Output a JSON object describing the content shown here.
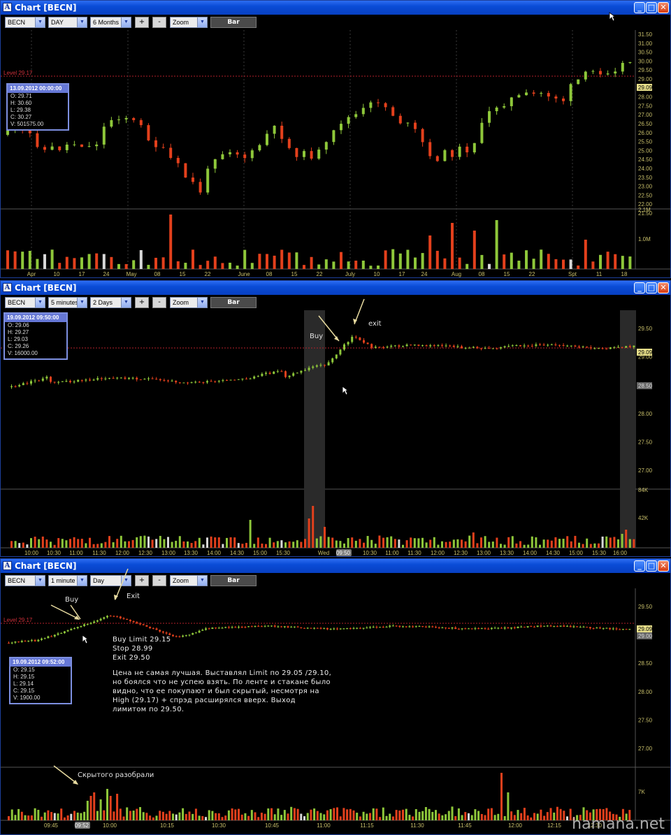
{
  "colors": {
    "up": "#8ec73a",
    "down": "#e3401c",
    "level": "#b3202a",
    "grid": "#3a3a3a",
    "axis": "#c8bf6a",
    "neutral": "#d8d8d8"
  },
  "windows": [
    {
      "title": "Chart [BECN]",
      "symbol": "BECN",
      "interval": "DAY",
      "range": "6 Months",
      "zoom_label": "Zoom",
      "plus_label": "+",
      "minus_label": "-",
      "bar_label": "Bar",
      "level_label": "Level 29.17",
      "info": {
        "date": "13.09.2012 00:00:00",
        "o": "O: 29.71",
        "h": "H: 30.60",
        "l": "L: 29.38",
        "c": "C: 30.27",
        "v": "V: 501575.00"
      },
      "price_ticks": [
        "31.50",
        "31.00",
        "30.50",
        "30.00",
        "29.50",
        "29.00",
        "28.50",
        "28.00",
        "27.50",
        "27.00",
        "26.50",
        "26.00",
        "25.50",
        "25.00",
        "24.50",
        "24.00",
        "23.50",
        "23.00",
        "22.50",
        "22.00",
        "21.50"
      ],
      "vol_ticks": [
        "2.1M",
        "1.0M"
      ],
      "time_ticks": [
        "Apr",
        "10",
        "17",
        "24",
        "May",
        "08",
        "15",
        "22",
        "June",
        "08",
        "15",
        "22",
        "July",
        "10",
        "17",
        "24",
        "Aug",
        "08",
        "15",
        "22",
        "Spt",
        "11",
        "18"
      ],
      "price_tag": "29.09"
    },
    {
      "title": "Chart [BECN]",
      "symbol": "BECN",
      "interval": "5 minutes",
      "range": "2 Days",
      "zoom_label": "Zoom",
      "plus_label": "+",
      "minus_label": "-",
      "bar_label": "Bar",
      "info": {
        "date": "19.09.2012 09:50:00",
        "o": "O: 29.06",
        "h": "H: 29.27",
        "l": "L: 29.03",
        "c": "C: 29.26",
        "v": "V: 16000.00"
      },
      "price_ticks": [
        "29.50",
        "29.00",
        "28.50",
        "28.00",
        "27.50",
        "27.00"
      ],
      "vol_ticks": [
        "84K",
        "42K"
      ],
      "time_ticks": [
        "10:00",
        "10:30",
        "11:00",
        "11:30",
        "12:00",
        "12:30",
        "13:00",
        "13:30",
        "14:00",
        "14:30",
        "15:00",
        "15:30",
        "Wed",
        "09:50",
        "10:30",
        "11:00",
        "11:30",
        "12:00",
        "12:30",
        "13:00",
        "13:30",
        "14:00",
        "14:30",
        "15:00",
        "15:30",
        "16:00"
      ],
      "price_tag": "29.09",
      "price_tag2": "28.50",
      "buy_label": "Buy",
      "exit_label": "exit"
    },
    {
      "title": "Chart [BECN]",
      "symbol": "BECN",
      "interval": "1 minute",
      "range": "Day",
      "zoom_label": "Zoom",
      "plus_label": "+",
      "minus_label": "-",
      "bar_label": "Bar",
      "level_label": "Level 29.17",
      "info": {
        "date": "19.09.2012 09:52:00",
        "o": "O: 29.15",
        "h": "H: 29.15",
        "l": "L: 29.14",
        "c": "C: 29.15",
        "v": "V: 1900.00"
      },
      "price_ticks": [
        "29.50",
        "29.00",
        "28.50",
        "28.00",
        "27.50",
        "27.00"
      ],
      "vol_ticks": [
        "7K"
      ],
      "time_ticks": [
        "09:45",
        "09:52",
        "10:00",
        "10:15",
        "10:30",
        "10:45",
        "11:00",
        "11:15",
        "11:30",
        "11:45",
        "12:00",
        "12:15",
        "12:30"
      ],
      "price_tag": "29.09",
      "price_tag2": "29.00",
      "buy_label": "Buy",
      "exit_label": "Exit",
      "order_lines": [
        "Buy Limit 29.15",
        "Stop 28.99",
        "Exit 29.50"
      ],
      "comment": [
        "Цена не самая лучшая. Выставлял Limit по 29.05 /29.10,",
        "но боялся что не успею взять. По ленте и стакане было",
        "видно, что ее покупают и был скрытый, несмотря на",
        "High (29.17) + спрэд расширялся вверх. Выход",
        "лимитом по 29.50."
      ],
      "hidden_note": "Скрытого разобрали"
    }
  ],
  "watermark": "hamana.net"
}
